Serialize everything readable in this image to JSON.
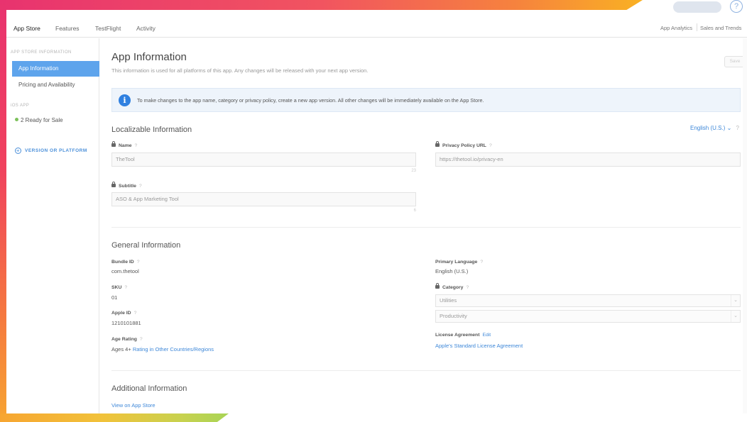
{
  "topbar": {
    "help_glyph": "?"
  },
  "nav": {
    "tabs": [
      "App Store",
      "Features",
      "TestFlight",
      "Activity"
    ],
    "right_links": [
      "App Analytics",
      "Sales and Trends"
    ]
  },
  "sidebar": {
    "section1": "APP STORE INFORMATION",
    "items": [
      "App Information",
      "Pricing and Availability"
    ],
    "section2": "iOS APP",
    "ready_label": "2 Ready for Sale",
    "add_label": "VERSION OR PLATFORM",
    "plus_glyph": "+"
  },
  "main": {
    "title": "App Information",
    "subtitle": "This information is used for all platforms of this app. Any changes will be released with your next app version.",
    "save_label": "Save",
    "banner": {
      "icon_glyph": "i",
      "text": "To make changes to the app name, category or privacy policy, create a new app version. All other changes will be immediately available on the App Store."
    },
    "localizable": {
      "title": "Localizable Information",
      "language": "English (U.S.)",
      "chevron": "⌄",
      "help": "?",
      "name_label": "Name",
      "name_value": "TheTool",
      "name_counter": "23",
      "subtitle_label": "Subtitle",
      "subtitle_value": "ASO & App Marketing Tool",
      "subtitle_counter": "6",
      "privacy_label": "Privacy Policy URL",
      "privacy_value": "https://thetool.io/privacy-en"
    },
    "general": {
      "title": "General Information",
      "bundle_label": "Bundle ID",
      "bundle_value": "com.thetool",
      "sku_label": "SKU",
      "sku_value": "01",
      "apple_id_label": "Apple ID",
      "apple_id_value": "1210101881",
      "age_label": "Age Rating",
      "age_value": "Ages 4+",
      "age_link": "Rating in Other Countries/Regions",
      "primary_lang_label": "Primary Language",
      "primary_lang_value": "English (U.S.)",
      "category_label": "Category",
      "category_primary": "Utilities",
      "category_secondary": "Productivity",
      "license_label": "License Agreement",
      "license_edit": "Edit",
      "license_link": "Apple's Standard License Agreement"
    },
    "additional": {
      "title": "Additional Information",
      "view_link": "View on App Store"
    }
  },
  "colors": {
    "accent": "#3d87d8",
    "sidebar_active": "#5ea4ec",
    "ready_dot": "#7cc15b",
    "frame_pink": "#e8336f",
    "frame_orange": "#f7a531"
  }
}
